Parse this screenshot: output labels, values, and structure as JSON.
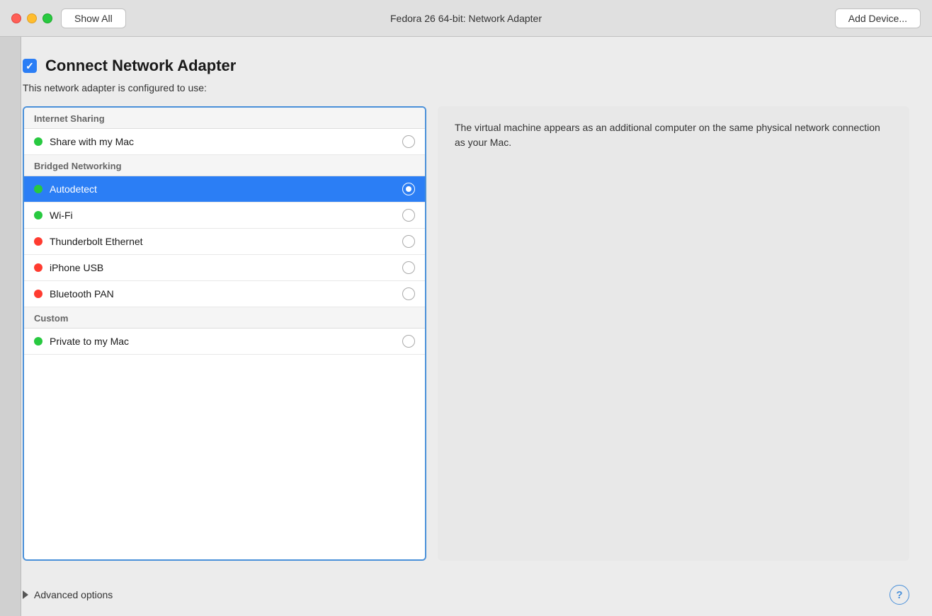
{
  "titlebar": {
    "show_all_label": "Show All",
    "title": "Fedora 26 64-bit: Network Adapter",
    "add_device_label": "Add Device..."
  },
  "main": {
    "checkbox_checked": true,
    "heading": "Connect Network Adapter",
    "subtitle": "This network adapter is configured to use:",
    "sections": [
      {
        "name": "Internet Sharing",
        "items": [
          {
            "label": "Share with my Mac",
            "dot_color": "green",
            "selected": false
          }
        ]
      },
      {
        "name": "Bridged Networking",
        "items": [
          {
            "label": "Autodetect",
            "dot_color": "green",
            "selected": true
          },
          {
            "label": "Wi-Fi",
            "dot_color": "green",
            "selected": false
          },
          {
            "label": "Thunderbolt Ethernet",
            "dot_color": "red",
            "selected": false
          },
          {
            "label": "iPhone USB",
            "dot_color": "red",
            "selected": false
          },
          {
            "label": "Bluetooth PAN",
            "dot_color": "red",
            "selected": false
          }
        ]
      },
      {
        "name": "Custom",
        "items": [
          {
            "label": "Private to my Mac",
            "dot_color": "green",
            "selected": false
          }
        ]
      }
    ],
    "description": "The virtual machine appears as an additional computer on the same physical network connection as your Mac."
  },
  "footer": {
    "advanced_options_label": "Advanced options",
    "help_label": "?"
  }
}
